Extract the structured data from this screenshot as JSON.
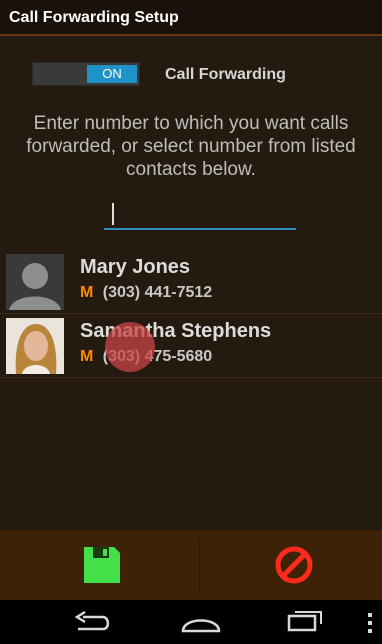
{
  "header": {
    "title": "Call Forwarding Setup"
  },
  "forwarding": {
    "toggle_state": "ON",
    "label": "Call Forwarding"
  },
  "instructions": {
    "line1": "Enter number to which you want calls",
    "line2": "forwarded, or select number from listed",
    "line3": "contacts below."
  },
  "number_input": {
    "value": "",
    "placeholder": ""
  },
  "contacts": [
    {
      "name": "Mary Jones",
      "type": "M",
      "phone": "(303) 441-7512",
      "avatar": "default-avatar"
    },
    {
      "name": "Samantha Stephens",
      "type": "M",
      "phone": "(303) 475-5680",
      "avatar": "photo-avatar"
    }
  ],
  "actions": {
    "save": {
      "icon": "save-icon",
      "color": "#44e04a"
    },
    "cancel": {
      "icon": "cancel-icon",
      "color": "#ff2a1a"
    }
  },
  "navigation": {
    "icons": [
      "back-icon",
      "home-icon",
      "recent-apps-icon",
      "menu-icon"
    ]
  },
  "colors": {
    "accent": "#1f93c7",
    "orange": "#ff8a00",
    "title_border": "#6a3410"
  }
}
